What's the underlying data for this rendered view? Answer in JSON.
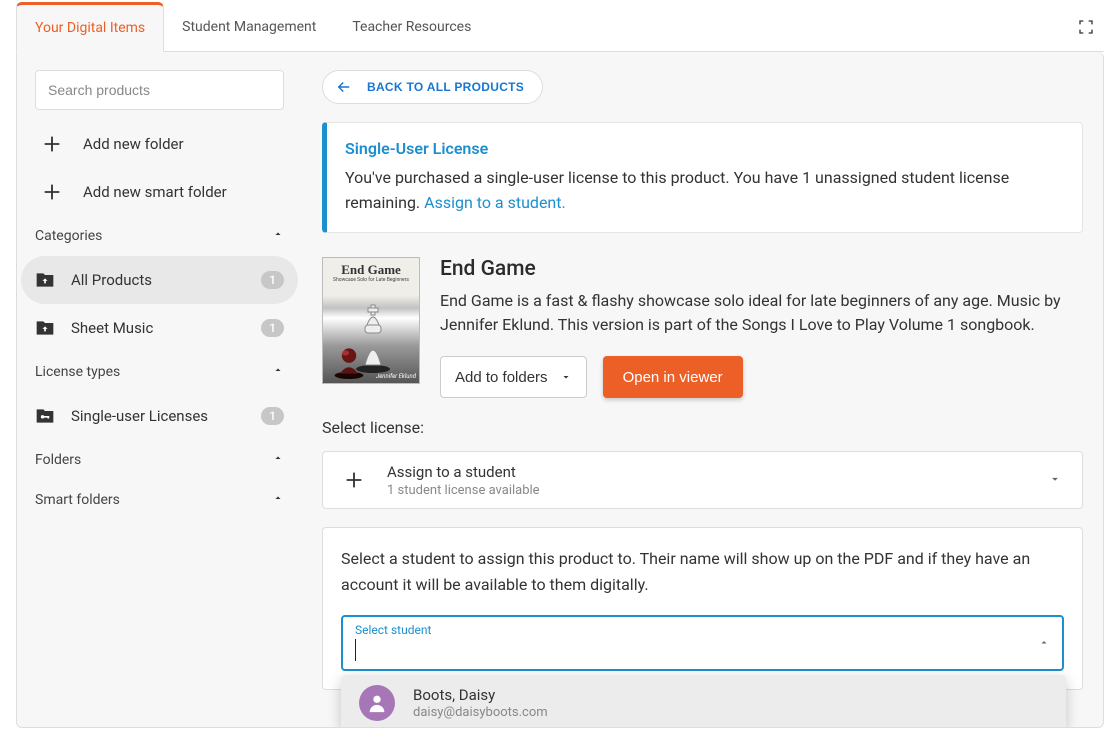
{
  "tabs": {
    "digital_items": "Your Digital Items",
    "student_mgmt": "Student Management",
    "teacher_res": "Teacher Resources"
  },
  "sidebar": {
    "search_placeholder": "Search products",
    "add_folder": "Add new folder",
    "add_smart_folder": "Add new smart folder",
    "categories_heading": "Categories",
    "all_products": {
      "label": "All Products",
      "count": "1"
    },
    "sheet_music": {
      "label": "Sheet Music",
      "count": "1"
    },
    "license_types_heading": "License types",
    "single_user": {
      "label": "Single-user Licenses",
      "count": "1"
    },
    "folders_heading": "Folders",
    "smart_folders_heading": "Smart folders"
  },
  "back_btn": "BACK TO ALL PRODUCTS",
  "callout": {
    "title": "Single-User License",
    "body_pre": "You've purchased a single-user license to this product. You have 1 unassigned student license remaining. ",
    "link": "Assign to a student."
  },
  "product": {
    "title": "End Game",
    "description": "End Game is a fast & flashy showcase solo ideal for late beginners of any age. Music by Jennifer Eklund. This version is part of the Songs I Love to Play Volume 1 songbook.",
    "add_to_folders": "Add to folders",
    "open_in_viewer": "Open in viewer",
    "cover_title": "End Game",
    "cover_sub": "Showcase Solo for Late Beginners",
    "cover_author": "Jennifer Eklund"
  },
  "license": {
    "select_label": "Select license:",
    "assign_title": "Assign to a student",
    "assign_sub": "1 student license available"
  },
  "assign_panel": {
    "text": "Select a student to assign this product to. Their name will show up on the PDF and if they have an account it will be available to them digitally.",
    "combo_label": "Select student"
  },
  "dropdown": {
    "name": "Boots, Daisy",
    "email": "daisy@daisyboots.com"
  }
}
